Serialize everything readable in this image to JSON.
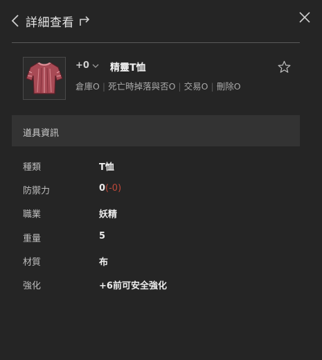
{
  "header": {
    "title": "詳細查看"
  },
  "item": {
    "enchant": "+0",
    "name": "精靈T恤",
    "properties": [
      "倉庫O",
      "死亡時掉落與否O",
      "交易O",
      "刪除O"
    ]
  },
  "section": {
    "title": "道具資訊"
  },
  "info": [
    {
      "label": "種類",
      "value": "T恤"
    },
    {
      "label": "防禦力",
      "value": "0",
      "delta": "(-0)"
    },
    {
      "label": "職業",
      "value": "妖精"
    },
    {
      "label": "重量",
      "value": "5"
    },
    {
      "label": "材質",
      "value": "布"
    },
    {
      "label": "強化",
      "value": "+6前可安全強化"
    }
  ],
  "colors": {
    "background": "#252525",
    "section_bg": "#333333",
    "delta": "#c0493a"
  },
  "icons": [
    "chevron-left-icon",
    "share-icon",
    "close-icon",
    "chevron-down-icon",
    "star-icon",
    "shirt-icon"
  ]
}
